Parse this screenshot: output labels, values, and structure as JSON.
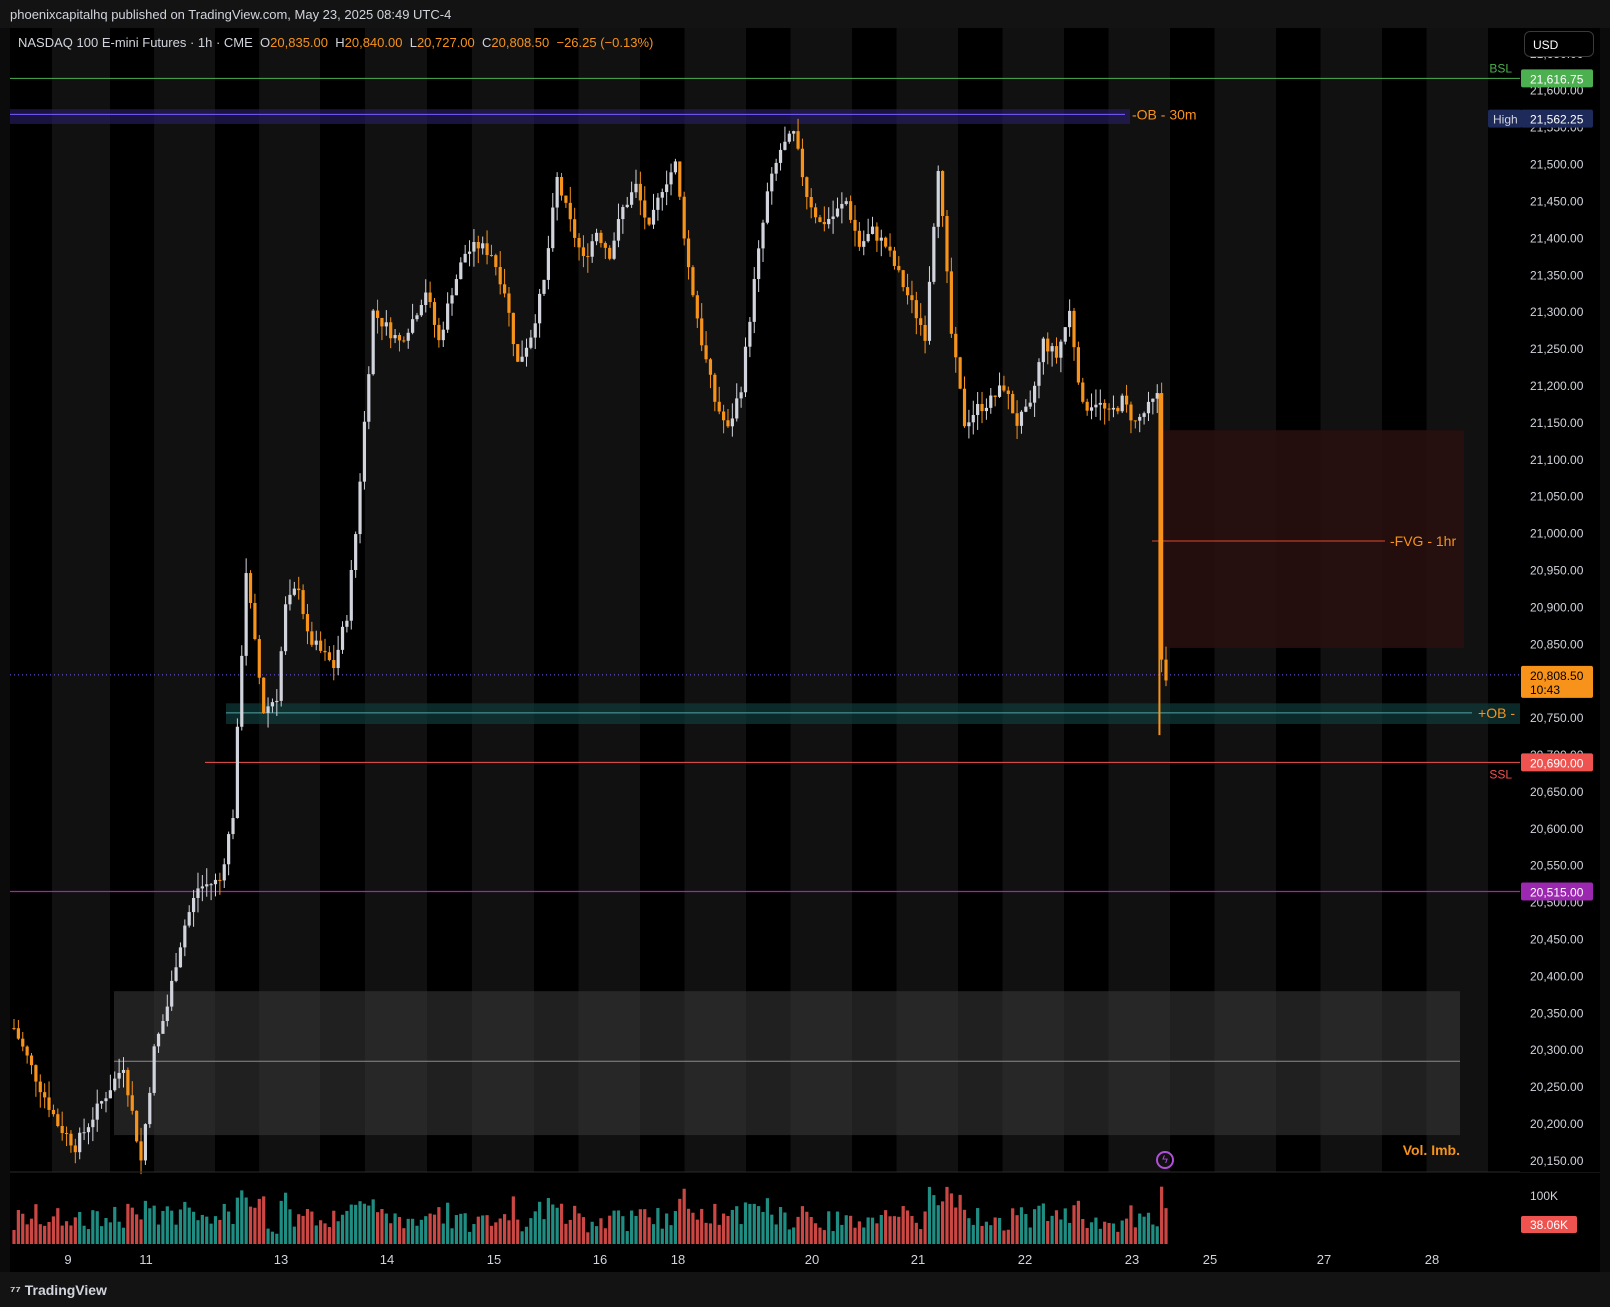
{
  "publish_line": "phoenixcapitalhq published on TradingView.com, May 23, 2025 08:49 UTC-4",
  "legend": {
    "symbol": "NASDAQ 100 E-mini Futures · 1h · CME",
    "o_label": "O",
    "o": "20,835.00",
    "h_label": "H",
    "h": "20,840.00",
    "l_label": "L",
    "l": "20,727.00",
    "c_label": "C",
    "c": "20,808.50",
    "change": "−26.25 (−0.13%)"
  },
  "currency": "USD",
  "footer_logo": "TradingView",
  "colors": {
    "up": "#d1d4dc",
    "down": "#f7931a",
    "vol_up": "#26a69a",
    "vol_down": "#ef5350",
    "bsl": "#4caf50",
    "ssl": "#ef5350",
    "purple": "#9c27b0",
    "ob_zone": "#2a1f6b",
    "fvg_zone": "#2a0f0f",
    "bull_ob": "#0f3b3b"
  },
  "chart_data": {
    "type": "candlestick",
    "timeframe": "1h",
    "x_ticks": [
      "9",
      "11",
      "13",
      "14",
      "15",
      "16",
      "18",
      "20",
      "21",
      "22",
      "23",
      "25",
      "27",
      "28"
    ],
    "y_ticks": [
      "21,650.00",
      "21,600.00",
      "21,550.00",
      "21,500.00",
      "21,450.00",
      "21,400.00",
      "21,350.00",
      "21,300.00",
      "21,250.00",
      "21,200.00",
      "21,150.00",
      "21,100.00",
      "21,050.00",
      "21,000.00",
      "20,950.00",
      "20,900.00",
      "20,850.00",
      "20,800.00",
      "20,750.00",
      "20,700.00",
      "20,650.00",
      "20,600.00",
      "20,550.00",
      "20,500.00",
      "20,450.00",
      "20,400.00",
      "20,350.00",
      "20,300.00",
      "20,250.00",
      "20,200.00",
      "20,150.00"
    ],
    "ylim": [
      20135,
      21685
    ],
    "price_path": [
      [
        0,
        20330
      ],
      [
        6,
        20250
      ],
      [
        10,
        20200
      ],
      [
        14,
        20170
      ],
      [
        18,
        20210
      ],
      [
        22,
        20250
      ],
      [
        25,
        20280
      ],
      [
        29,
        20150
      ],
      [
        32,
        20300
      ],
      [
        35,
        20360
      ],
      [
        37,
        20420
      ],
      [
        39,
        20470
      ],
      [
        42,
        20520
      ],
      [
        47,
        20530
      ],
      [
        50,
        20620
      ],
      [
        53,
        20950
      ],
      [
        55,
        20850
      ],
      [
        57,
        20760
      ],
      [
        60,
        20780
      ],
      [
        62,
        20900
      ],
      [
        65,
        20930
      ],
      [
        67,
        20860
      ],
      [
        70,
        20840
      ],
      [
        73,
        20820
      ],
      [
        76,
        20890
      ],
      [
        78,
        21000
      ],
      [
        80,
        21150
      ],
      [
        82,
        21300
      ],
      [
        85,
        21280
      ],
      [
        88,
        21260
      ],
      [
        91,
        21290
      ],
      [
        94,
        21330
      ],
      [
        97,
        21260
      ],
      [
        100,
        21330
      ],
      [
        103,
        21380
      ],
      [
        106,
        21390
      ],
      [
        109,
        21380
      ],
      [
        112,
        21330
      ],
      [
        115,
        21230
      ],
      [
        118,
        21270
      ],
      [
        121,
        21340
      ],
      [
        124,
        21480
      ],
      [
        127,
        21420
      ],
      [
        130,
        21370
      ],
      [
        133,
        21410
      ],
      [
        136,
        21380
      ],
      [
        139,
        21440
      ],
      [
        142,
        21470
      ],
      [
        145,
        21410
      ],
      [
        148,
        21470
      ],
      [
        151,
        21500
      ],
      [
        154,
        21360
      ],
      [
        157,
        21260
      ],
      [
        160,
        21180
      ],
      [
        163,
        21140
      ],
      [
        166,
        21200
      ],
      [
        169,
        21340
      ],
      [
        172,
        21460
      ],
      [
        175,
        21520
      ],
      [
        178,
        21540
      ],
      [
        181,
        21460
      ],
      [
        184,
        21420
      ],
      [
        187,
        21430
      ],
      [
        190,
        21450
      ],
      [
        193,
        21390
      ],
      [
        196,
        21410
      ],
      [
        199,
        21390
      ],
      [
        202,
        21350
      ],
      [
        205,
        21310
      ],
      [
        208,
        21270
      ],
      [
        211,
        21500
      ],
      [
        214,
        21270
      ],
      [
        217,
        21150
      ],
      [
        220,
        21170
      ],
      [
        223,
        21180
      ],
      [
        226,
        21200
      ],
      [
        229,
        21150
      ],
      [
        232,
        21170
      ],
      [
        235,
        21260
      ],
      [
        238,
        21240
      ],
      [
        241,
        21300
      ],
      [
        244,
        21170
      ],
      [
        247,
        21180
      ],
      [
        250,
        21160
      ],
      [
        253,
        21180
      ],
      [
        256,
        21150
      ],
      [
        259,
        21170
      ],
      [
        261,
        21185
      ],
      [
        262,
        20830
      ],
      [
        263,
        20808.5
      ]
    ],
    "volume_max_label": "100K",
    "current_volume": "38.06K",
    "annotations": {
      "bsl": {
        "label": "BSL",
        "price": 21616.75,
        "price_label": "21,616.75"
      },
      "high": {
        "label": "High",
        "price": 21562.25,
        "price_label": "21,562.25"
      },
      "ob_30m": {
        "label": "-OB - 30m",
        "top": 21575,
        "bottom": 21555
      },
      "fvg_1hr": {
        "label": "-FVG - 1hr",
        "top": 21140,
        "bottom": 20845,
        "mid": 20990
      },
      "last_price": {
        "price": 20808.5,
        "price_label": "20,808.50",
        "countdown": "10:43"
      },
      "bull_ob": {
        "label": "+OB -",
        "top": 20770,
        "bottom": 20742,
        "mid": 20757
      },
      "ssl": {
        "label": "SSL",
        "price": 20690,
        "price_label": "20,690.00"
      },
      "level_purple": {
        "price": 20515,
        "price_label": "20,515.00"
      },
      "vol_imb": {
        "label": "Vol. Imb.",
        "top": 20380,
        "bottom": 20185,
        "mid": 20285
      }
    }
  }
}
